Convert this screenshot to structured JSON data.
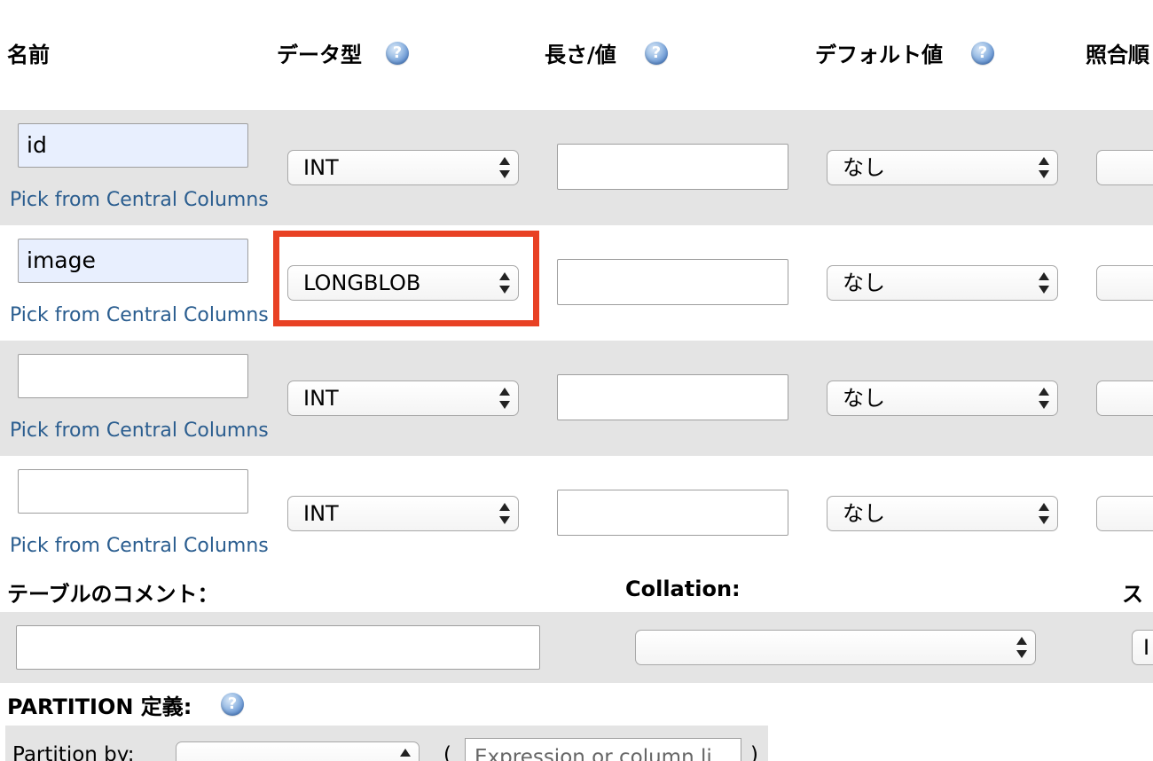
{
  "headers": {
    "name": "名前",
    "type": "データ型",
    "length": "長さ/値",
    "default": "デフォルト値",
    "collation": "照合順"
  },
  "help_icon_glyph": "?",
  "rows": [
    {
      "name_value": "id",
      "pick_link": "Pick from Central Columns",
      "type": "INT",
      "length_value": "",
      "default": "なし"
    },
    {
      "name_value": "image",
      "pick_link": "Pick from Central Columns",
      "type": "LONGBLOB",
      "length_value": "",
      "default": "なし"
    },
    {
      "name_value": "",
      "pick_link": "Pick from Central Columns",
      "type": "INT",
      "length_value": "",
      "default": "なし"
    },
    {
      "name_value": "",
      "pick_link": "Pick from Central Columns",
      "type": "INT",
      "length_value": "",
      "default": "なし"
    }
  ],
  "table_comment": {
    "label": "テーブルのコメント：",
    "value": ""
  },
  "collation": {
    "label": "Collation:",
    "value": ""
  },
  "storage_engine": {
    "label": "ス",
    "value": "I"
  },
  "partition": {
    "label": "PARTITION 定義:",
    "partition_by_label": "Partition by:",
    "open_paren": "(",
    "close_paren": ")",
    "expression_placeholder": "Expression or column li"
  },
  "colors": {
    "highlight": "#e84124",
    "link": "#2a5d8f",
    "row_gray": "#e4e4e4",
    "filled_input": "#e8effe"
  }
}
